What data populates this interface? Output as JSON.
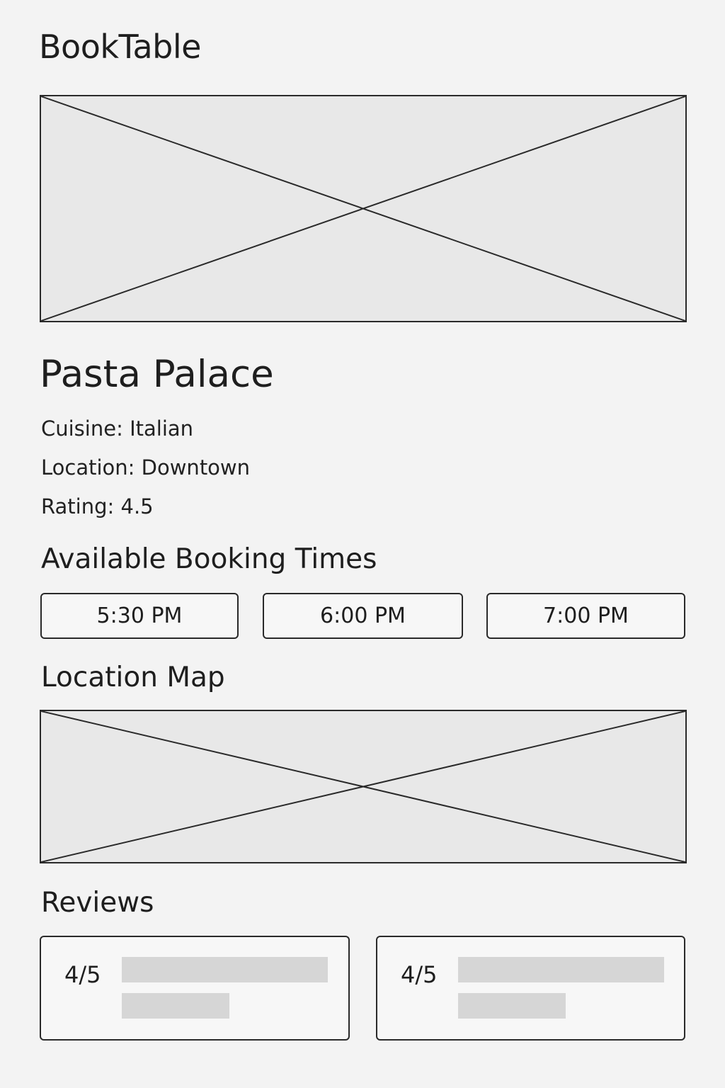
{
  "app": {
    "title": "BookTable"
  },
  "restaurant": {
    "name": "Pasta Palace",
    "cuisine": "Cuisine: Italian",
    "location": "Location: Downtown",
    "rating": "Rating: 4.5"
  },
  "booking": {
    "heading": "Available Booking Times",
    "times": [
      "5:30 PM",
      "6:00 PM",
      "7:00 PM"
    ]
  },
  "map": {
    "heading": "Location Map"
  },
  "reviews": {
    "heading": "Reviews",
    "items": [
      {
        "score": "4/5"
      },
      {
        "score": "4/5"
      }
    ]
  }
}
